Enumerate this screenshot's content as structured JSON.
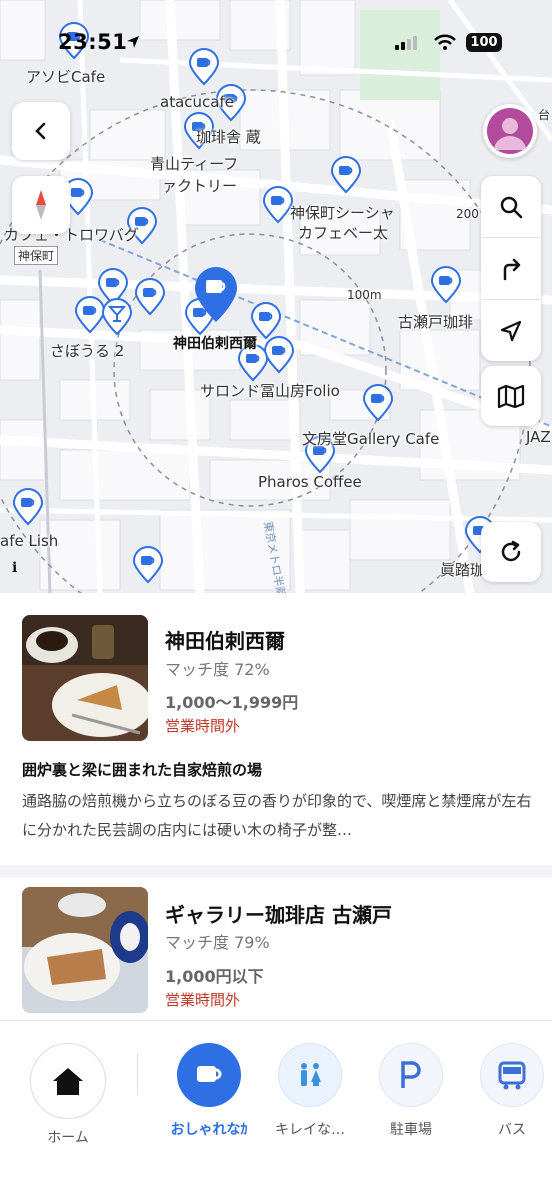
{
  "status_bar": {
    "time": "23:51",
    "battery": "100"
  },
  "map": {
    "labels": {
      "asobi": "アソビCafe",
      "atacu": "atacucafe",
      "kohikan": "珈琲舎 蔵",
      "aoyama1": "青山ティーフ",
      "aoyama2": "ァクトリー",
      "jimbocho1": "神保町シーシャ",
      "jimbocho2": "カフェベー太",
      "torowa": "カフェ・トロワバグ",
      "jimbocho_station": "神保町",
      "saboru": "さぼうる 2",
      "kanda": "神田伯剌西爾",
      "dist100": "100m",
      "dist200": "200",
      "furuseto": "古瀬戸珈琲",
      "salon": "サロンド冨山房Folio",
      "bunpodo": "文房堂Gallery Cafe",
      "pharos": "Pharos Coffee",
      "lish": "afe Lish",
      "jaz": "JAZ",
      "shinro": "眞踏珈",
      "taitou": "台",
      "street": "東京メトロ半蔵"
    }
  },
  "cards": [
    {
      "name": "神田伯剌西爾",
      "match": "マッチ度 72%",
      "price": "1,000～1,999円",
      "status": "営業時間外",
      "headline": "囲炉裏と梁に囲まれた自家焙煎の場",
      "description": "通路脇の焙煎機から立ちのぼる豆の香りが印象的で、喫煙席と禁煙席が左右に分かれた民芸調の店内には硬い木の椅子が整…"
    },
    {
      "name": "ギャラリー珈琲店 古瀬戸",
      "match": "マッチ度 79%",
      "price": "1,000円以下",
      "status": "営業時間外"
    }
  ],
  "bottom_nav": {
    "home": "ホーム",
    "cafe": "おしゃれなｶ",
    "toilet": "キレイな…",
    "parking": "駐車場",
    "bus": "バス"
  },
  "colors": {
    "accent": "#2f6fe4",
    "closed": "#c0392b"
  }
}
